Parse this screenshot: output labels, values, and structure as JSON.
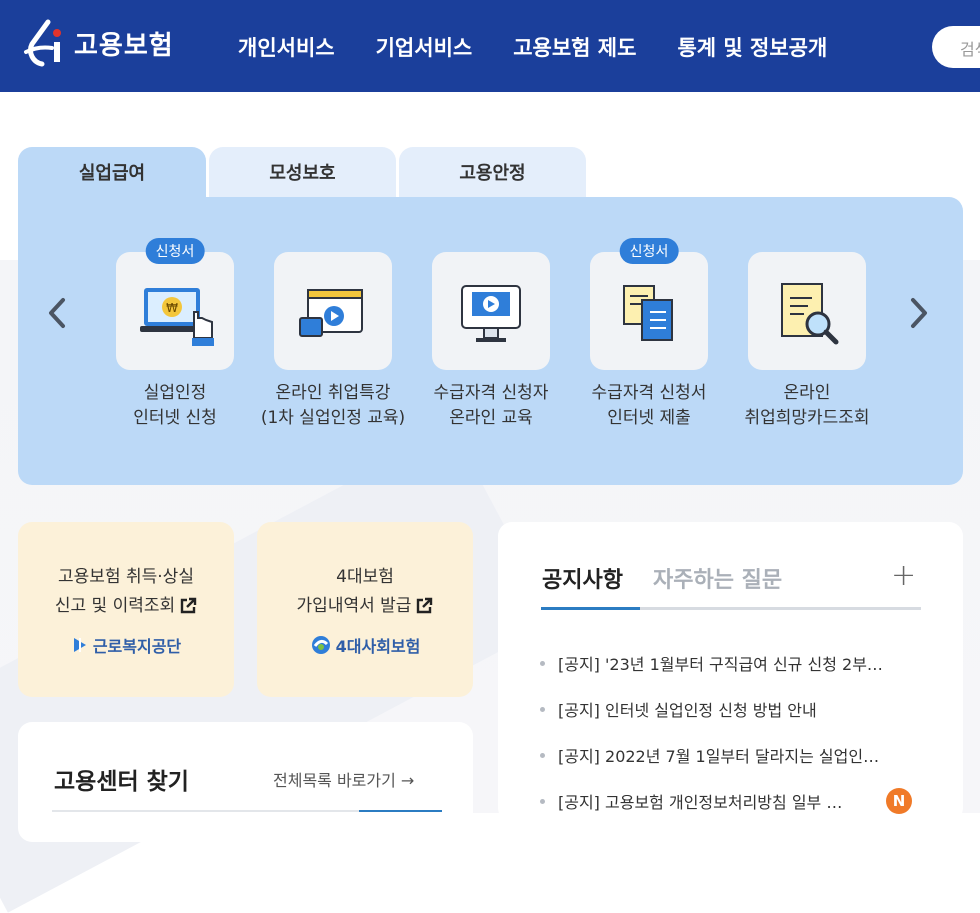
{
  "header": {
    "logo_text": "고용보험",
    "nav": [
      "개인서비스",
      "기업서비스",
      "고용보험 제도",
      "통계 및 정보공개"
    ],
    "search_placeholder": "검색"
  },
  "tabs": [
    "실업급여",
    "모성보호",
    "고용안정"
  ],
  "services": [
    {
      "line1": "실업인정",
      "line2": "인터넷 신청",
      "badge": "신청서",
      "icon": "laptop-payment-icon"
    },
    {
      "line1": "온라인 취업특강",
      "line2": "(1차 실업인정 교육)",
      "badge": "",
      "icon": "video-lecture-icon"
    },
    {
      "line1": "수급자격 신청자",
      "line2": "온라인 교육",
      "badge": "",
      "icon": "monitor-play-icon"
    },
    {
      "line1": "수급자격 신청서",
      "line2": "인터넷 제출",
      "badge": "신청서",
      "icon": "documents-icon"
    },
    {
      "line1": "온라인",
      "line2": "취업희망카드조회",
      "badge": "",
      "icon": "document-search-icon"
    }
  ],
  "cards": [
    {
      "line1": "고용보험 취득·상실",
      "line2": "신고 및 이력조회",
      "org": "근로복지공단"
    },
    {
      "line1": "4대보험",
      "line2": "가입내역서 발급",
      "org": "4대사회보험"
    }
  ],
  "notice": {
    "tab_active": "공지사항",
    "tab_inactive": "자주하는 질문",
    "more": "+",
    "items": [
      "[공지] '23년 1월부터 구직급여 신규 신청 2부…",
      "[공지] 인터넷 실업인정 신청 방법 안내",
      "[공지] 2022년 7월 1일부터 달라지는 실업인…",
      "[공지] 고용보험 개인정보처리방침 일부 …"
    ],
    "new_badge": "N"
  },
  "center": {
    "title": "고용센터 찾기",
    "link": "전체목록 바로가기 →"
  },
  "colors": {
    "header_bg": "#1b3f9b",
    "panel_bg": "#bcd9f7",
    "badge_bg": "#2f7ed9",
    "card_bg": "#fcf1d9",
    "new_badge": "#f07a28"
  }
}
